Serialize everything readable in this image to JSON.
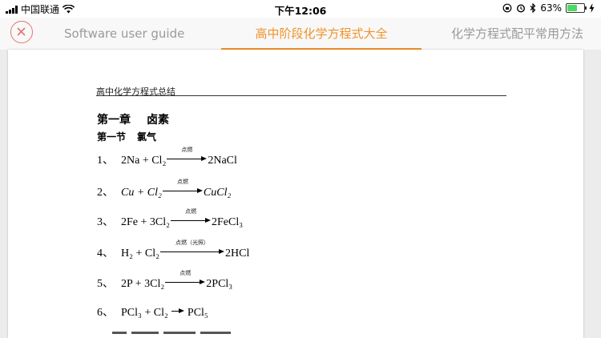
{
  "status_bar": {
    "carrier": "中国联通",
    "time": "下午12:06",
    "battery_percent": "63%",
    "battery_level": 0.63
  },
  "tabs": [
    {
      "label": "Software user guide",
      "active": false
    },
    {
      "label": "高中阶段化学方程式大全",
      "active": true
    },
    {
      "label": "化学方程式配平常用方法",
      "active": false
    }
  ],
  "colors": {
    "accent": "#f0932b",
    "close": "#e2766f",
    "inactive_tab": "#9a9a9a"
  },
  "document": {
    "header": "高中化学方程式总结",
    "chapter_number": "第一章",
    "chapter_title": "卤素",
    "section_number": "第一节",
    "section_title": "氯气",
    "equations": [
      {
        "num": "1、",
        "lhs": "2Na + Cl₂",
        "condition": "点燃",
        "rhs": "2NaCl"
      },
      {
        "num": "2、",
        "lhs": "Cu + Cl₂",
        "condition": "点燃",
        "rhs": "CuCl₂"
      },
      {
        "num": "3、",
        "lhs": "2Fe + 3Cl₂",
        "condition": "点燃",
        "rhs": "2FeCl₃"
      },
      {
        "num": "4、",
        "lhs": "H₂ + Cl₂",
        "condition": "点燃（光照）",
        "rhs": "2HCl"
      },
      {
        "num": "5、",
        "lhs": "2P + 3Cl₂",
        "condition": "点燃",
        "rhs": "2PCl₃"
      },
      {
        "num": "6、",
        "lhs": "PCl₃ + Cl₂",
        "condition": "",
        "rhs": "PCl₅"
      }
    ]
  }
}
